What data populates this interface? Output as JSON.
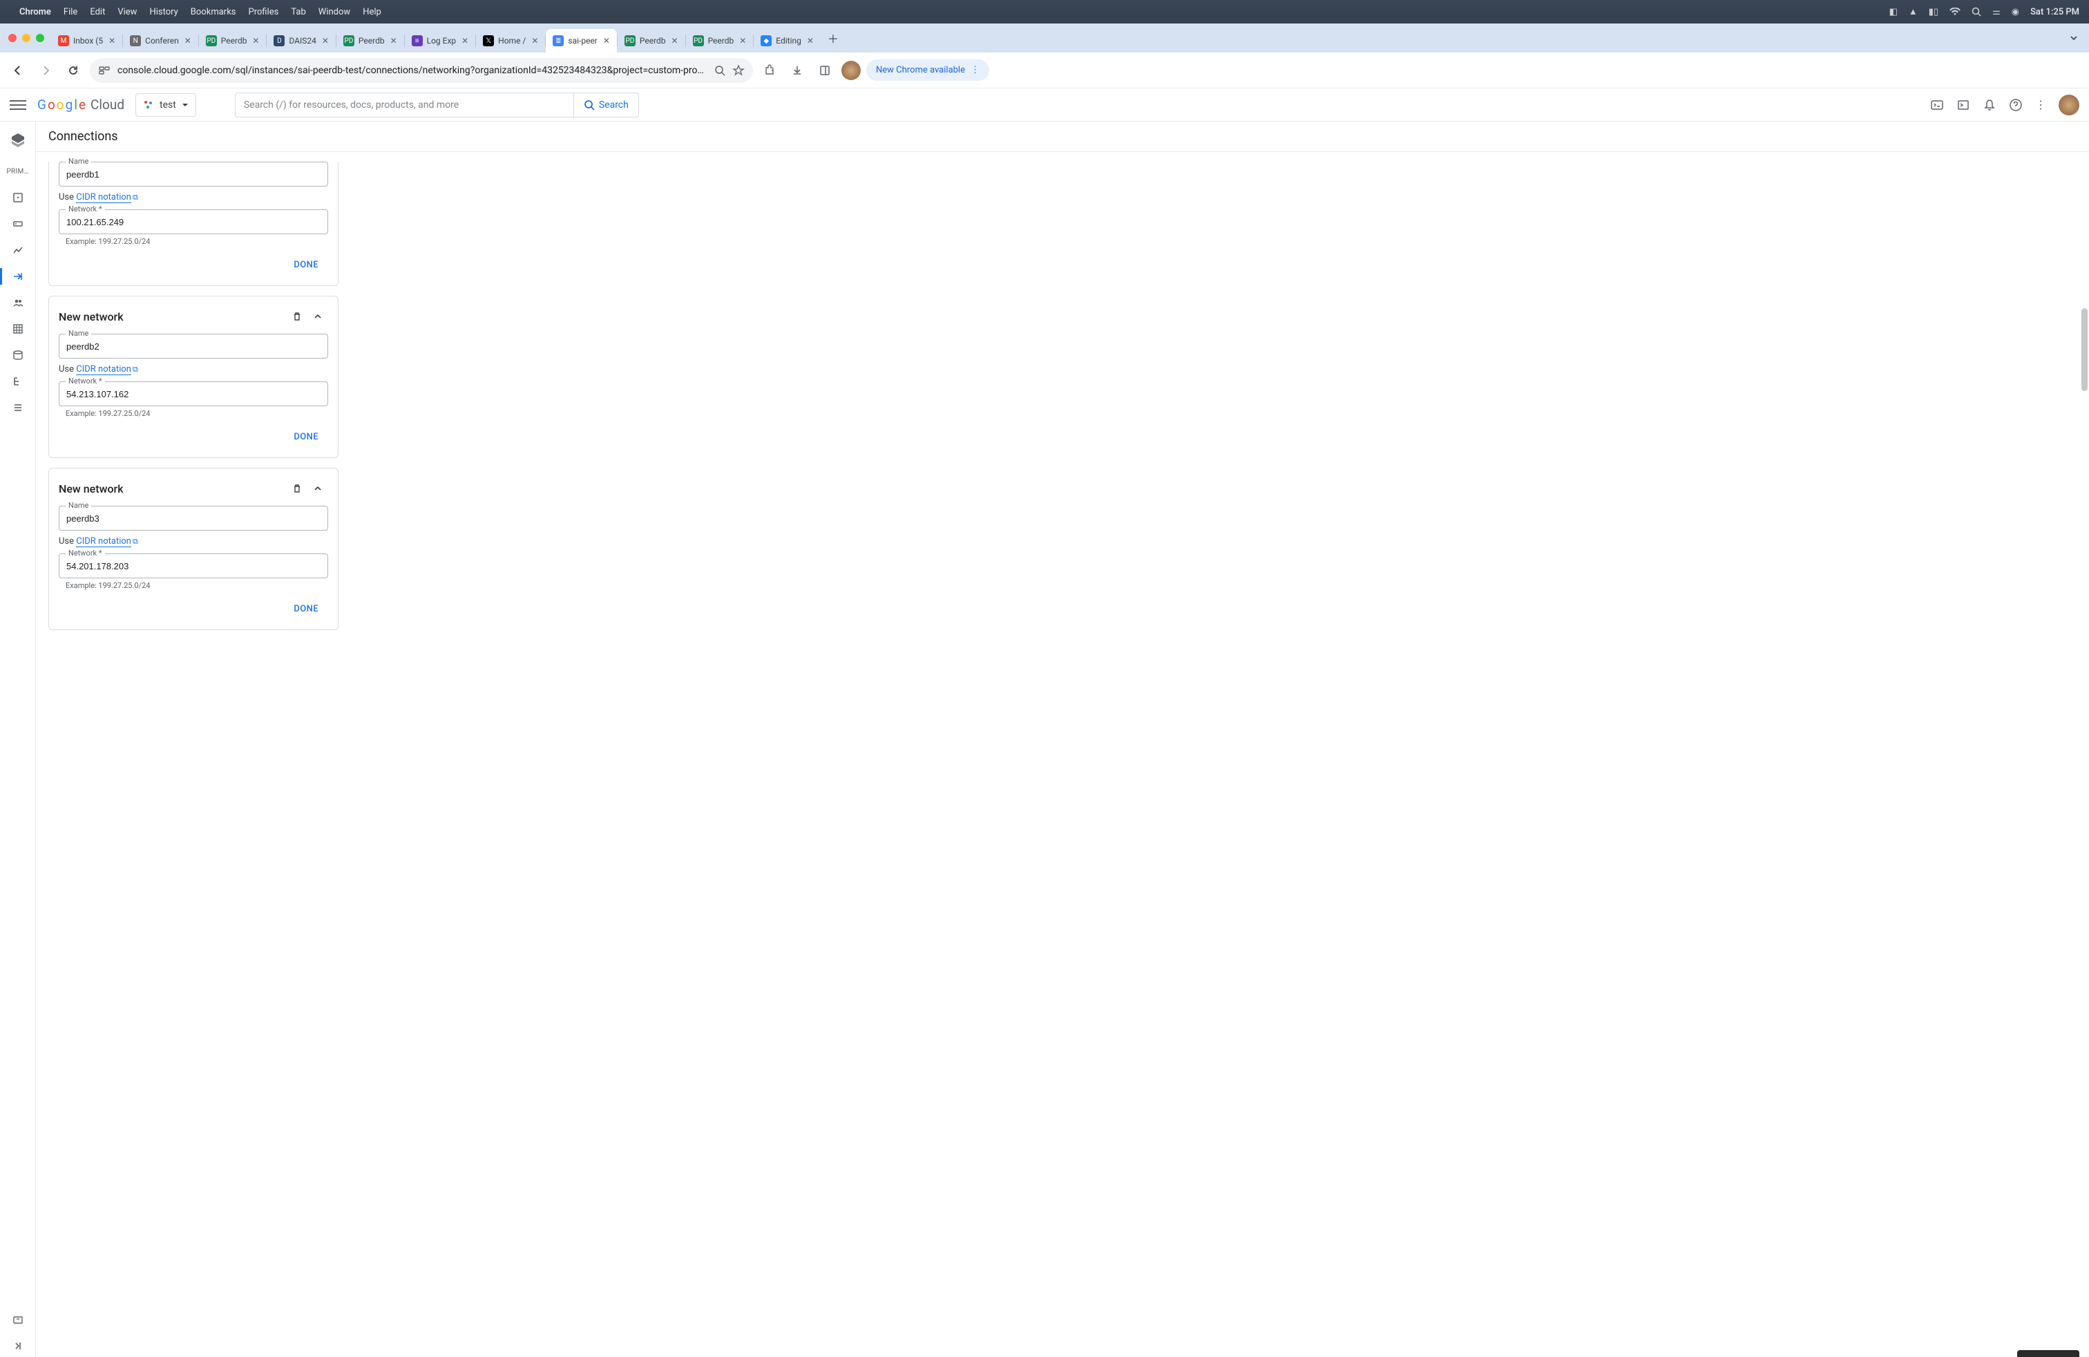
{
  "menubar": {
    "app": "Chrome",
    "items": [
      "File",
      "Edit",
      "View",
      "History",
      "Bookmarks",
      "Profiles",
      "Tab",
      "Window",
      "Help"
    ],
    "clock": "Sat 1:25 PM"
  },
  "tabs": [
    {
      "label": "Inbox (5",
      "fav": "gmail"
    },
    {
      "label": "Conferen",
      "fav": "notion"
    },
    {
      "label": "Peerdb",
      "fav": "pd"
    },
    {
      "label": "DAIS24",
      "fav": "dais"
    },
    {
      "label": "Peerdb",
      "fav": "pd"
    },
    {
      "label": "Log Exp",
      "fav": "gcp"
    },
    {
      "label": "Home /",
      "fav": "x"
    },
    {
      "label": "sai-peer",
      "fav": "sql",
      "active": true
    },
    {
      "label": "Peerdb",
      "fav": "pd"
    },
    {
      "label": "Peerdb",
      "fav": "pd"
    },
    {
      "label": "Editing",
      "fav": "jira"
    }
  ],
  "toolbar": {
    "url": "console.cloud.google.com/sql/instances/sai-peerdb-test/connections/networking?organizationId=432523484323&project=custom-progra…",
    "update": "New Chrome available"
  },
  "gcp": {
    "logo": "Google Cloud",
    "project": "test",
    "search_placeholder": "Search (/) for resources, docs, products, and more",
    "search_btn": "Search"
  },
  "rail": {
    "primary": "PRIM…"
  },
  "page": {
    "title": "Connections",
    "use_prefix": "Use ",
    "cidr_link": "CIDR notation",
    "name_label": "Name",
    "network_label": "Network *",
    "example": "Example: 199.27.25.0/24",
    "done": "DONE",
    "newnet": "New network",
    "cards": [
      {
        "name_value": "peerdb1",
        "network_value": "100.21.65.249",
        "has_header": false
      },
      {
        "name_value": "peerdb2",
        "network_value": "54.213.107.162",
        "has_header": true
      },
      {
        "name_value": "peerdb3",
        "network_value": "54.201.178.203",
        "has_header": true
      }
    ]
  }
}
